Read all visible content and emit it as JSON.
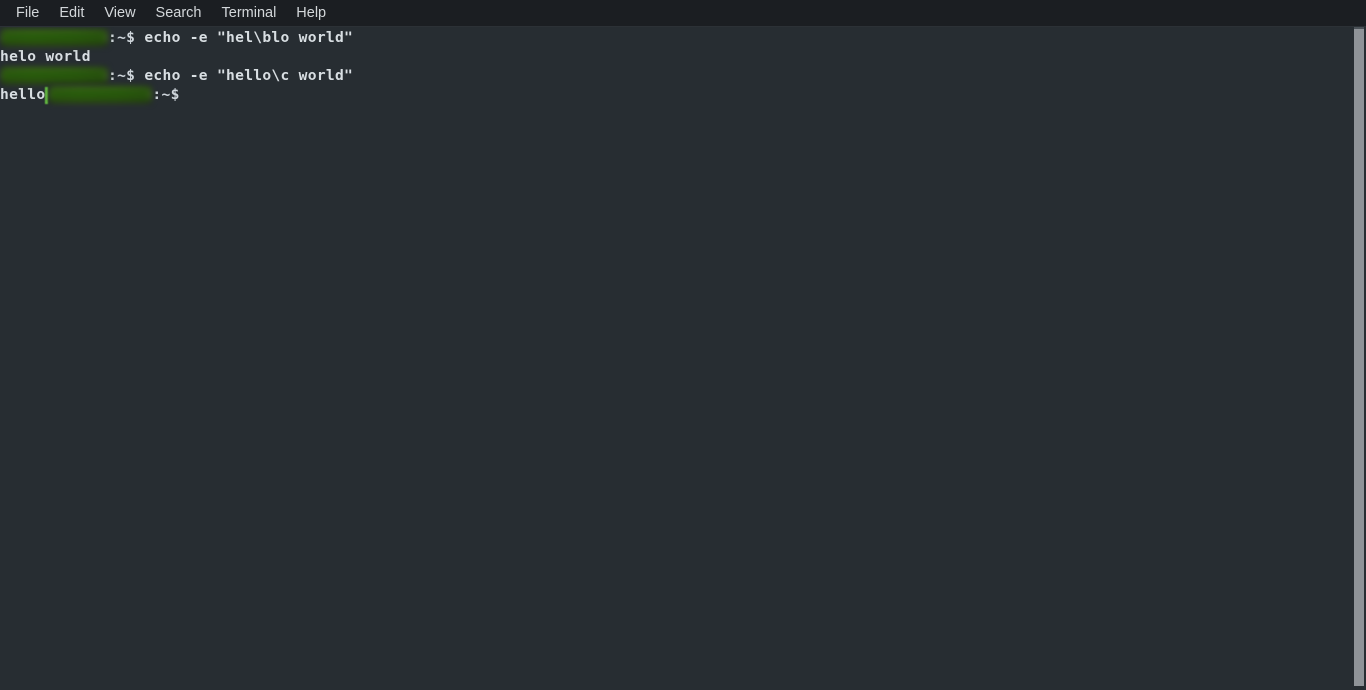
{
  "window": {
    "title": "Terminal",
    "background_color": "#272d32",
    "menubar_color": "#1b1e22",
    "text_color": "#d8dee2",
    "redaction_color": "#689c34"
  },
  "menubar": {
    "items": [
      {
        "label": "File",
        "name": "menu-file"
      },
      {
        "label": "Edit",
        "name": "menu-edit"
      },
      {
        "label": "View",
        "name": "menu-view"
      },
      {
        "label": "Search",
        "name": "menu-search"
      },
      {
        "label": "Terminal",
        "name": "menu-terminal"
      },
      {
        "label": "Help",
        "name": "menu-help"
      }
    ]
  },
  "terminal": {
    "prompt_separator": ":~$ ",
    "prompt_separator_trailing": ":~$",
    "lines": [
      {
        "type": "prompt",
        "redacted_user_host": true,
        "separator": ":~$ ",
        "command": "echo -e \"hel\\blo world\""
      },
      {
        "type": "output",
        "text": "helo world"
      },
      {
        "type": "prompt",
        "redacted_user_host": true,
        "separator": ":~$ ",
        "command": "echo -e \"hello\\c world\""
      },
      {
        "type": "output_then_prompt",
        "output": "hello",
        "redacted_user_host": true,
        "separator": ":~$"
      }
    ]
  },
  "scrollbar": {
    "name": "vertical-scrollbar",
    "position": "right"
  }
}
